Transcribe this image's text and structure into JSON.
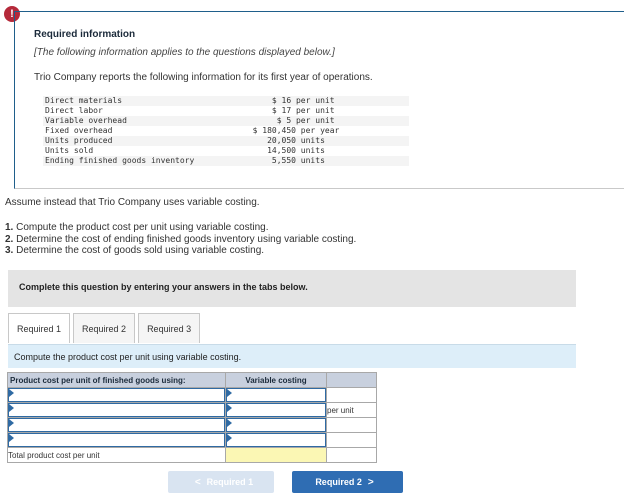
{
  "alert": {
    "icon": "exclamation-icon",
    "symbol": "!"
  },
  "info": {
    "title": "Required information",
    "note": "[The following information applies to the questions displayed below.]",
    "intro": "Trio Company reports the following information for its first year of operations.",
    "items": [
      {
        "label": "Direct materials",
        "value": "      $ 16 per unit"
      },
      {
        "label": "Direct labor",
        "value": "      $ 17 per unit"
      },
      {
        "label": "Variable overhead",
        "value": "       $ 5 per unit"
      },
      {
        "label": "Fixed overhead",
        "value": "  $ 180,450 per year"
      },
      {
        "label": "Units produced",
        "value": "     20,050 units"
      },
      {
        "label": "Units sold",
        "value": "     14,500 units"
      },
      {
        "label": "Ending finished goods inventory",
        "value": "      5,550 units"
      }
    ]
  },
  "assume": "Assume instead that Trio Company uses variable costing.",
  "tasks": [
    {
      "num": "1.",
      "text": "Compute the product cost per unit using variable costing."
    },
    {
      "num": "2.",
      "text": "Determine the cost of ending finished goods inventory using variable costing."
    },
    {
      "num": "3.",
      "text": "Determine the cost of goods sold using variable costing."
    }
  ],
  "complete_text": "Complete this question by entering your answers in the tabs below.",
  "tabs": [
    {
      "label": "Required 1",
      "active": true
    },
    {
      "label": "Required 2",
      "active": false
    },
    {
      "label": "Required 3",
      "active": false
    }
  ],
  "instruction": "Compute the product cost per unit using variable costing.",
  "grid": {
    "header_label": "Product cost per unit of finished goods using:",
    "header_col": "Variable costing",
    "unit_text": "per unit",
    "total_label": "Total product cost per unit"
  },
  "nav": {
    "prev_label": "Required 1",
    "next_label": "Required 2",
    "prev_chevron": "<",
    "next_chevron": ">"
  },
  "colors": {
    "alert": "#b5293a",
    "accent": "#2f6db3",
    "total_highlight": "#fbf7b4"
  }
}
